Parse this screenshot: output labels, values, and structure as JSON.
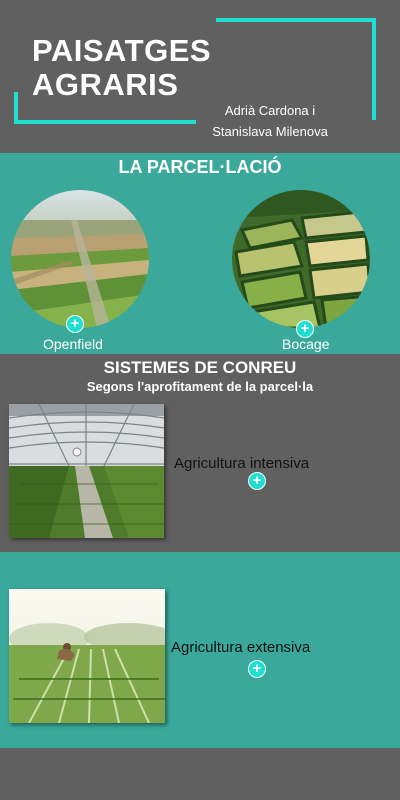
{
  "header": {
    "title_line1": "PAISATGES",
    "title_line2": "AGRARIS",
    "author_line1": "Adrià Cardona i",
    "author_line2": "Stanislava Milenova"
  },
  "parcel": {
    "title": "LA PARCEL·LACIÓ",
    "items": [
      {
        "label": "Openfield",
        "plus": "+"
      },
      {
        "label": "Bocage",
        "plus": "+"
      }
    ]
  },
  "systems": {
    "title": "SISTEMES DE CONREU",
    "subtitle": "Segons l'aprofitament de la parcel·la",
    "items": [
      {
        "label": "Agricultura intensiva",
        "plus": "+"
      },
      {
        "label": "Agricultura extensiva",
        "plus": "+"
      }
    ]
  },
  "colors": {
    "accent": "#1fe0d0",
    "teal_band": "#3aa89a",
    "grey_band": "#606060"
  },
  "icons": [
    "plus-circle-icon"
  ]
}
